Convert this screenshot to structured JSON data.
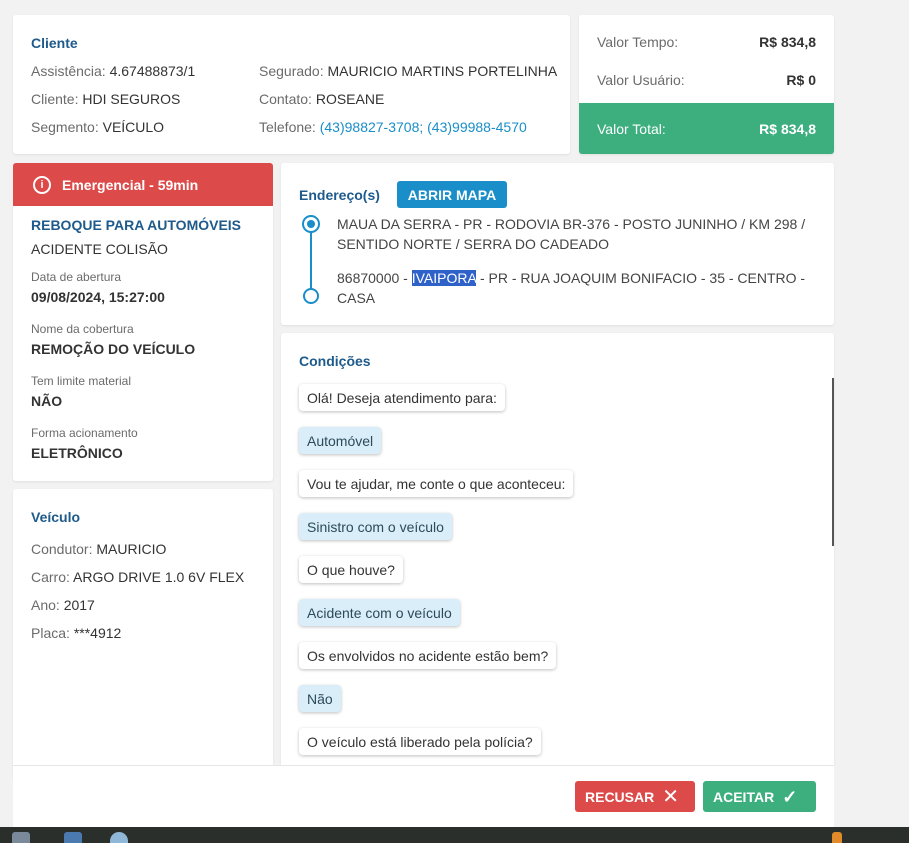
{
  "cliente": {
    "title": "Cliente",
    "assistencia_label": "Assistência:",
    "assistencia_value": "4.67488873/1",
    "cliente_label": "Cliente:",
    "cliente_value": "HDI SEGUROS",
    "segmento_label": "Segmento:",
    "segmento_value": "VEÍCULO",
    "segurado_label": "Segurado:",
    "segurado_value": "MAURICIO MARTINS PORTELINHA",
    "contato_label": "Contato:",
    "contato_value": "ROSEANE",
    "telefone_label": "Telefone:",
    "telefone_value": "(43)98827-3708; (43)99988-4570"
  },
  "valores": {
    "tempo_label": "Valor Tempo:",
    "tempo_value": "R$ 834,8",
    "usuario_label": "Valor Usuário:",
    "usuario_value": "R$ 0",
    "total_label": "Valor Total:",
    "total_value": "R$ 834,8"
  },
  "emergencial": {
    "label": "Emergencial - 59min",
    "icon": "info-icon"
  },
  "servico": {
    "tipo": "REBOQUE PARA AUTOMÓVEIS",
    "motivo": "ACIDENTE COLISÃO",
    "data_label": "Data de abertura",
    "data_value": "09/08/2024, 15:27:00",
    "cobertura_label": "Nome da cobertura",
    "cobertura_value": "REMOÇÃO DO VEÍCULO",
    "limite_label": "Tem limite material",
    "limite_value": "NÃO",
    "forma_label": "Forma acionamento",
    "forma_value": "ELETRÔNICO"
  },
  "veiculo": {
    "title": "Veículo",
    "condutor_label": "Condutor:",
    "condutor_value": "MAURICIO",
    "carro_label": "Carro:",
    "carro_value": "ARGO DRIVE 1.0 6V FLEX",
    "ano_label": "Ano:",
    "ano_value": "2017",
    "placa_label": "Placa:",
    "placa_value": "***4912"
  },
  "endereco": {
    "title": "Endereço(s)",
    "mapa_button": "ABRIR MAPA",
    "origem": "MAUA DA SERRA - PR - RODOVIA BR-376 - POSTO JUNINHO / KM 298 / SENTIDO NORTE / SERRA DO CADEADO",
    "destino_prefix": "86870000 - ",
    "destino_highlight": "IVAIPORA",
    "destino_suffix": " - PR - RUA JOAQUIM BONIFACIO - 35 - CENTRO - CASA"
  },
  "condicoes": {
    "title": "Condições",
    "messages": [
      {
        "type": "q",
        "text": "Olá! Deseja atendimento para:"
      },
      {
        "type": "a",
        "text": "Automóvel"
      },
      {
        "type": "q",
        "text": "Vou te ajudar, me conte o que aconteceu:"
      },
      {
        "type": "a",
        "text": "Sinistro com o veículo"
      },
      {
        "type": "q",
        "text": "O que houve?"
      },
      {
        "type": "a",
        "text": "Acidente com o veículo"
      },
      {
        "type": "q",
        "text": "Os envolvidos no acidente estão bem?"
      },
      {
        "type": "a",
        "text": "Não"
      },
      {
        "type": "q",
        "text": "O veículo está liberado pela polícia?"
      }
    ]
  },
  "footer": {
    "recusar_label": "RECUSAR",
    "aceitar_label": "ACEITAR"
  },
  "colors": {
    "primary": "#1a8ec8",
    "danger": "#dc4a4a",
    "success": "#3daf7f",
    "title": "#1e5a8c"
  }
}
